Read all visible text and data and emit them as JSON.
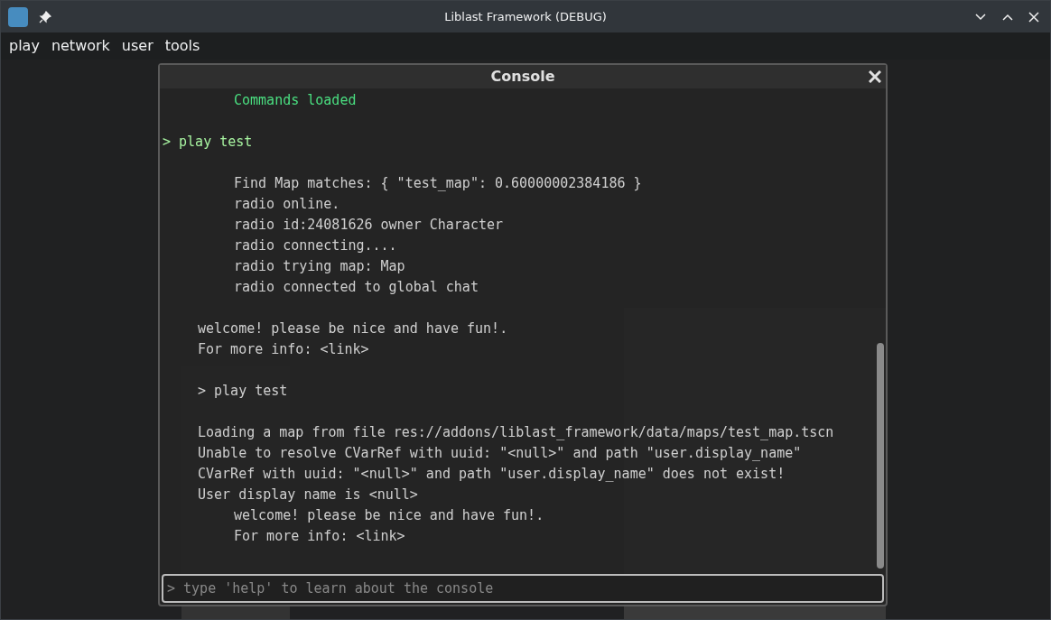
{
  "window": {
    "title": "Liblast Framework (DEBUG)"
  },
  "menu": [
    "play",
    "network",
    "user",
    "tools"
  ],
  "console": {
    "title": "Console",
    "blocks": [
      {
        "lines": [
          {
            "kind": "status",
            "text": "Commands loaded"
          }
        ]
      },
      {
        "lines": [
          {
            "kind": "command",
            "text": "> play test"
          }
        ]
      },
      {
        "lines": [
          {
            "kind": "output",
            "text": "Find Map matches: { \"test_map\": 0.60000002384186 }"
          },
          {
            "kind": "output",
            "text": "radio online."
          },
          {
            "kind": "output",
            "text": "radio id:24081626 owner Character"
          },
          {
            "kind": "output",
            "text": "radio connecting...."
          },
          {
            "kind": "output",
            "text": "radio trying map: Map"
          },
          {
            "kind": "output",
            "text": "radio connected to global chat"
          }
        ]
      },
      {
        "lines": [
          {
            "kind": "message",
            "text": "welcome! please be nice and have fun!."
          },
          {
            "kind": "message",
            "text": "For more info: <link>"
          }
        ]
      },
      {
        "lines": [
          {
            "kind": "message",
            "text": "> play test"
          }
        ]
      },
      {
        "lines": [
          {
            "kind": "message",
            "text": "Loading a map from file res://addons/liblast_framework/data/maps/test_map.tscn"
          },
          {
            "kind": "message",
            "text": "Unable to resolve CVarRef with uuid: \"<null>\" and path \"user.display_name\""
          },
          {
            "kind": "message",
            "text": "CVarRef with uuid: \"<null>\" and path \"user.display_name\" does not exist!"
          },
          {
            "kind": "message",
            "text": "User display name is <null>"
          },
          {
            "kind": "output",
            "text": "welcome! please be nice and have fun!."
          },
          {
            "kind": "output",
            "text": "For more info: <link>"
          }
        ]
      }
    ],
    "input": {
      "placeholder": "> type 'help' to learn about the console"
    }
  }
}
